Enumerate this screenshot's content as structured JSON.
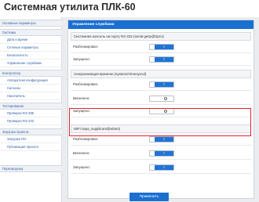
{
  "header": {
    "title": "Системная утилита ПЛК-60"
  },
  "sidebar": {
    "groups": [
      {
        "label": "Основные параметры"
      },
      {
        "label": "Система",
        "items": [
          "Дата и время",
          "Сетевые параметры",
          "Безопасность",
          "Управление службами"
        ]
      },
      {
        "label": "Контроллер",
        "items": [
          "Аппаратная конфигурация",
          "Сигналы",
          "Накопитель"
        ]
      },
      {
        "label": "Тестирование",
        "items": [
          "Проверка RS-485",
          "Проверка RS-232"
        ]
      },
      {
        "label": "Загрузка проекта",
        "items": [
          "Загрузка ПО",
          "Публикация проекта"
        ]
      },
      {
        "label": "Перезагрузка"
      }
    ]
  },
  "panel": {
    "title": "Управление службами",
    "sections": [
      {
        "title": "Системная консоль на порту RS-232 (serial-getty@ttyS1)",
        "rows": [
          {
            "label": "Разблокирован:",
            "state": "on"
          },
          {
            "label": "Запущено:",
            "state": "on"
          }
        ]
      },
      {
        "title": "Синхронизация времени (systemd-timesyncd)",
        "rows": [
          {
            "label": "Разблокирован:",
            "state": "on"
          },
          {
            "label": "Включено:",
            "state": "off"
          },
          {
            "label": "Запущено:",
            "state": "off"
          }
        ]
      },
      {
        "title": "WiFi (wpa_supplicant@wlan0)",
        "rows": [
          {
            "label": "Разблокирован:",
            "state": "on"
          },
          {
            "label": "Включено:",
            "state": "on"
          },
          {
            "label": "Запущено:",
            "state": "on"
          }
        ]
      }
    ],
    "toggle_on_glyph": "I",
    "apply_label": "Применить"
  },
  "colors": {
    "accent": "#1a6fd1",
    "highlight": "#e0242f"
  }
}
